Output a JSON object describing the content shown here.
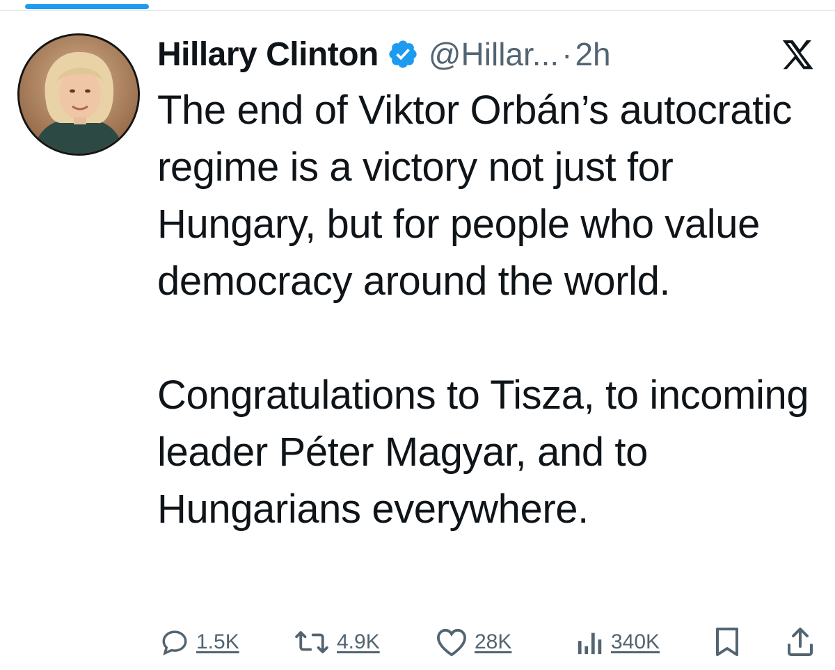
{
  "tweet": {
    "author_name": "Hillary Clinton",
    "handle": "@Hillar...",
    "separator": "·",
    "time_ago": "2h",
    "text": "The end of Viktor Orbán’s autocratic regime is a victory not just for Hungary, but for people who value democracy around the world.\n\nCongratulations to Tisza, to incoming leader Péter Magyar, and to Hungarians everywhere."
  },
  "actions": {
    "replies": "1.5K",
    "reposts": "4.9K",
    "likes": "28K",
    "views": "340K"
  },
  "icons": {
    "verified": "verified-badge-icon",
    "platform": "x-logo-icon",
    "reply": "reply-icon",
    "repost": "repost-icon",
    "like": "heart-icon",
    "views": "views-chart-icon",
    "bookmark": "bookmark-icon",
    "share": "share-icon"
  },
  "colors": {
    "accent": "#1d9bf0",
    "text_primary": "#0f1419",
    "text_secondary": "#536471"
  }
}
